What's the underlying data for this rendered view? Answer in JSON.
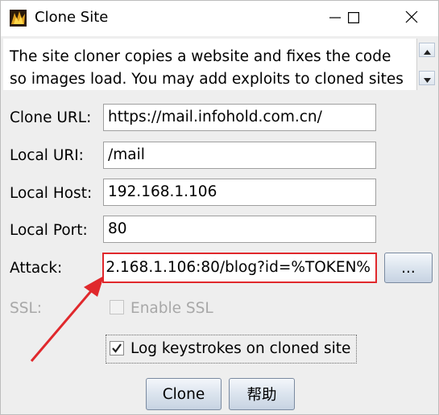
{
  "window": {
    "title": "Clone Site",
    "icon": "cobalt-strike-app-icon"
  },
  "title_buttons": {
    "minimize": "minimize-icon",
    "maximize": "maximize-icon",
    "close": "close-icon"
  },
  "description": "The site cloner copies a website and fixes the code\nso images load. You may add exploits to cloned sites",
  "form": {
    "clone_url_label": "Clone URL:",
    "clone_url_value": "https://mail.infohold.com.cn/",
    "local_uri_label": "Local URI:",
    "local_uri_value": "/mail",
    "local_host_label": "Local Host:",
    "local_host_value": "192.168.1.106",
    "local_port_label": "Local Port:",
    "local_port_value": "80",
    "attack_label": "Attack:",
    "attack_value": "2.168.1.106:80/blog?id=%TOKEN%",
    "attack_browse_label": "...",
    "ssl_label": "SSL:",
    "ssl_checkbox_label": "Enable SSL",
    "ssl_checked": false,
    "log_checkbox_label": "Log keystrokes on cloned site",
    "log_checked": true
  },
  "buttons": {
    "clone": "Clone",
    "help": "帮助"
  },
  "annotation": {
    "color": "#e0282c"
  }
}
